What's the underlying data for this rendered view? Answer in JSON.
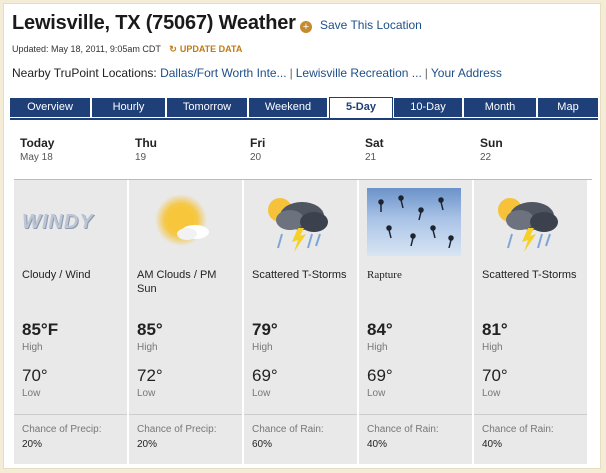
{
  "header": {
    "title": "Lewisville, TX (75067) Weather",
    "save_label": "Save This Location",
    "updated": "Updated: May 18, 2011, 9:05am CDT",
    "update_label": "UPDATE DATA",
    "nearby_label": "Nearby TruPoint Locations:",
    "nearby_links": [
      "Dallas/Fort Worth Inte...",
      "Lewisville Recreation ...",
      "Your Address"
    ]
  },
  "tabs": [
    "Overview",
    "Hourly",
    "Tomorrow",
    "Weekend",
    "5-Day",
    "10-Day",
    "Month",
    "Map"
  ],
  "active_tab": "5-Day",
  "days": [
    {
      "name": "Today",
      "date": "May 18",
      "cond": "Cloudy / Wind",
      "icon": "windy-icon",
      "icon_text": "WINDY",
      "hi": "85°F",
      "hi_label": "High",
      "lo": "70°",
      "lo_label": "Low",
      "precip_label": "Chance of Precip:",
      "precip": "20%"
    },
    {
      "name": "Thu",
      "date": "19",
      "cond": "AM Clouds / PM Sun",
      "icon": "partly-sunny-icon",
      "hi": "85°",
      "hi_label": "High",
      "lo": "72°",
      "lo_label": "Low",
      "precip_label": "Chance of Precip:",
      "precip": "20%"
    },
    {
      "name": "Fri",
      "date": "20",
      "cond": "Scattered T-Storms",
      "icon": "thunderstorm-icon",
      "hi": "79°",
      "hi_label": "High",
      "lo": "69°",
      "lo_label": "Low",
      "precip_label": "Chance of Rain:",
      "precip": "60%"
    },
    {
      "name": "Sat",
      "date": "21",
      "cond": "Rapture",
      "icon": "rapture-image",
      "hi": "84°",
      "hi_label": "High",
      "lo": "69°",
      "lo_label": "Low",
      "precip_label": "Chance of Rain:",
      "precip": "40%"
    },
    {
      "name": "Sun",
      "date": "22",
      "cond": "Scattered T-Storms",
      "icon": "thunderstorm-icon",
      "hi": "81°",
      "hi_label": "High",
      "lo": "70°",
      "lo_label": "Low",
      "precip_label": "Chance of Rain:",
      "precip": "40%"
    }
  ],
  "colors": {
    "tab_bg": "#1f3f78",
    "link": "#1f4f8a",
    "update": "#c07a12",
    "panel": "#e9e9e9"
  }
}
